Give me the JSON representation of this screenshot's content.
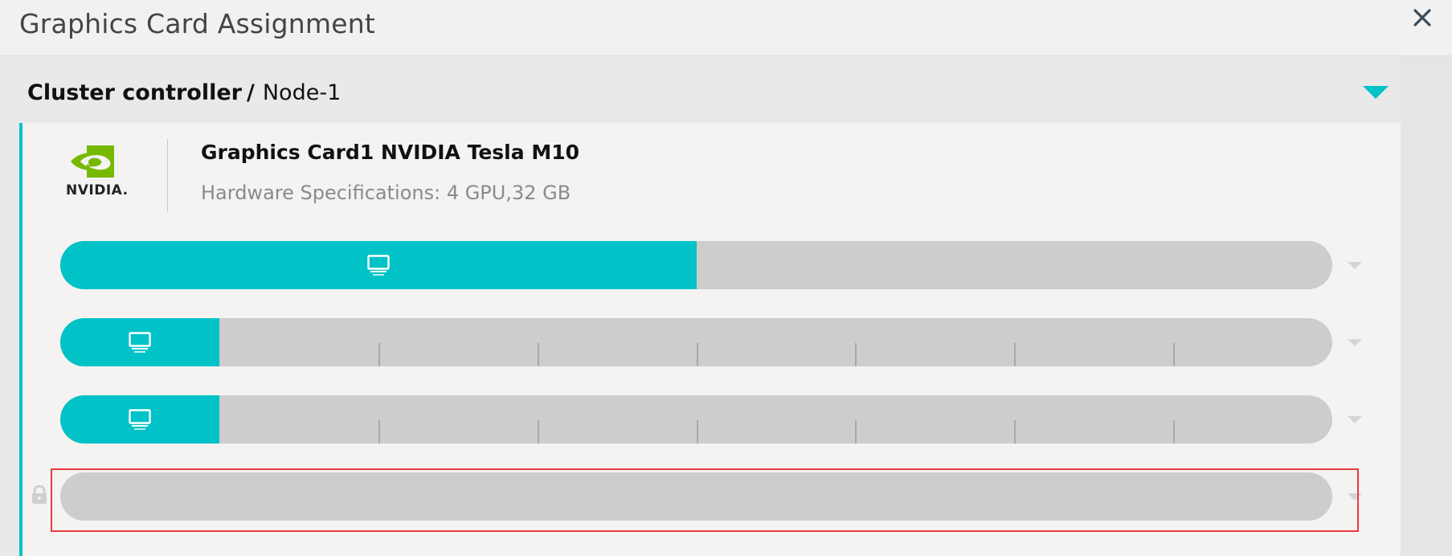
{
  "window": {
    "title": "Graphics Card Assignment",
    "close_icon": "close-icon"
  },
  "breadcrumb": {
    "parent": "Cluster controller",
    "separator": "/",
    "current": "Node-1"
  },
  "colors": {
    "accent": "#00c2c7",
    "track": "#cecccc",
    "selection": "#e8393f",
    "logo_green": "#76b900"
  },
  "card": {
    "logo_text": "NVIDIA.",
    "name": "Graphics Card1 NVIDIA Tesla M10",
    "spec": "Hardware Specifications: 4 GPU,32 GB"
  },
  "gpus": [
    {
      "allocated_fraction": 0.5,
      "segments": 1,
      "icon": "monitor-icon",
      "locked": false
    },
    {
      "allocated_fraction": 0.125,
      "segments": 8,
      "icon": "monitor-icon",
      "locked": false
    },
    {
      "allocated_fraction": 0.125,
      "segments": 8,
      "icon": "monitor-icon",
      "locked": false
    },
    {
      "allocated_fraction": 0,
      "segments": 1,
      "icon": null,
      "locked": true,
      "selected": true
    }
  ]
}
